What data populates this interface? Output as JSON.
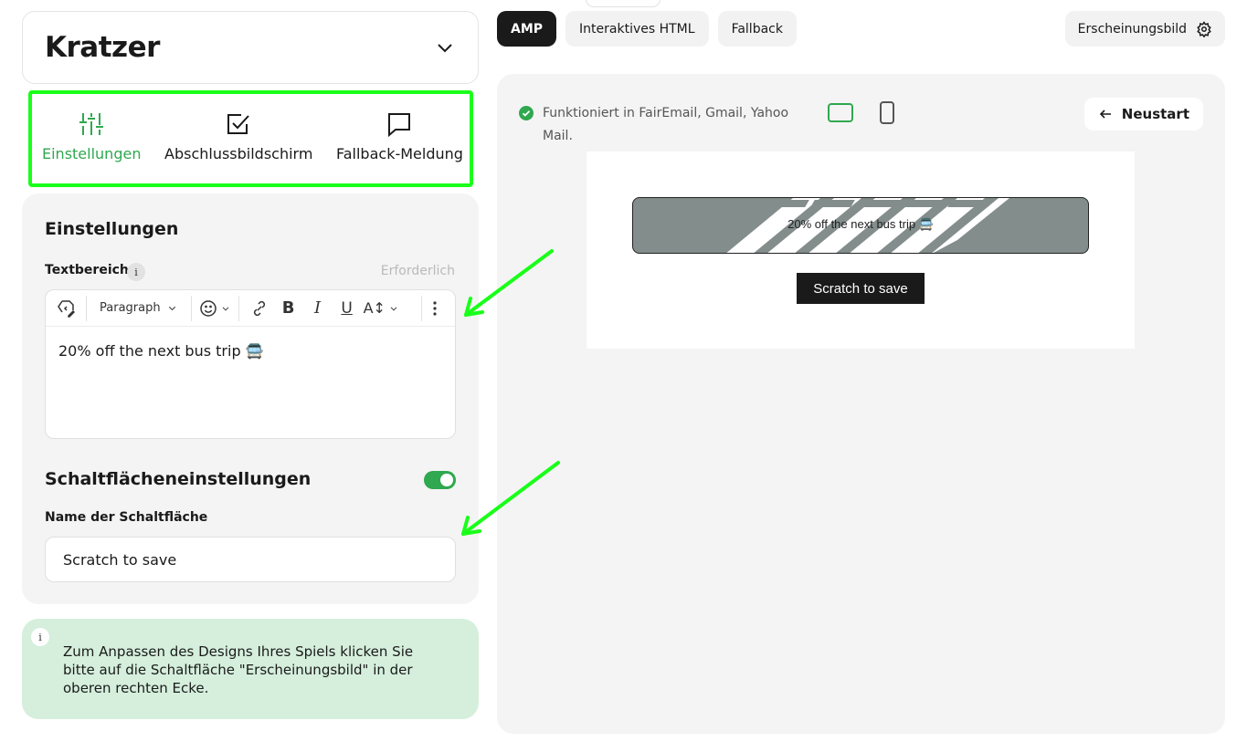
{
  "game": {
    "title": "Kratzer"
  },
  "left_tabs": [
    {
      "label": "Einstellungen",
      "icon": "sliders-icon",
      "active": true
    },
    {
      "label": "Abschlussbildschirm",
      "icon": "checkbox-icon",
      "active": false
    },
    {
      "label": "Fallback-Meldung",
      "icon": "message-icon",
      "active": false
    }
  ],
  "settings": {
    "title": "Einstellungen",
    "textarea_label": "Textbereich",
    "info_glyph": "i",
    "required": "Erforderlich",
    "toolbar": {
      "paragraph": "Paragraph",
      "bold": "B",
      "italic": "I",
      "underline": "U",
      "font_size": "A↕"
    },
    "textarea_value": "20% off the next bus trip 🚍",
    "button_section_title": "Schaltflächeneinstellungen",
    "button_toggle_on": true,
    "button_name_label": "Name der Schaltfläche",
    "button_name_value": "Scratch to save"
  },
  "hint": {
    "glyph": "i",
    "text": "Zum Anpassen des Designs Ihres Spiels klicken Sie bitte auf die Schaltfläche \"Erscheinungsbild\" in der oberen rechten Ecke."
  },
  "mode_tabs": [
    {
      "label": "AMP",
      "active": true
    },
    {
      "label": "Interaktives HTML",
      "active": false
    },
    {
      "label": "Fallback",
      "active": false
    }
  ],
  "appearance_button": "Erscheinungsbild",
  "preview": {
    "compat_text": "Funktioniert in FairEmail, Gmail, Yahoo Mail.",
    "restart_label": "Neustart",
    "scratch_text": "20% off the next bus trip 🚍",
    "scratch_button": "Scratch to save"
  },
  "colors": {
    "accent": "#2fa84f",
    "highlight": "#19ff19",
    "panel": "#f4f4f4",
    "hint_bg": "#d5efdc",
    "scratch": "#838d8c"
  }
}
